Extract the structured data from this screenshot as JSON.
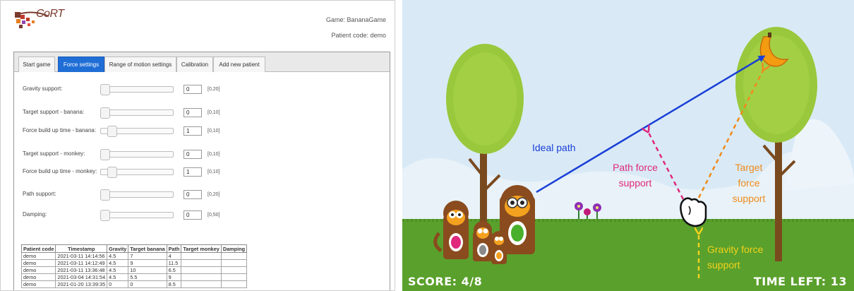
{
  "header": {
    "logo_text": "CoRT",
    "game_line": "Game: BananaGame",
    "patient_line": "Patient code: demo"
  },
  "tabs": [
    {
      "label": "Start game",
      "active": false
    },
    {
      "label": "Force settings",
      "active": true
    },
    {
      "label": "Range of motion settings",
      "active": false
    },
    {
      "label": "Calibration",
      "active": false
    },
    {
      "label": "Add new patient",
      "active": false
    }
  ],
  "settings": [
    {
      "label": "Gravity support:",
      "value": "0",
      "range": "[0,20]"
    },
    {
      "label": "Target support - banana:",
      "value": "0",
      "range": "[0,10]"
    },
    {
      "label": "Force build up time - banana:",
      "value": "1",
      "range": "[0,10]"
    },
    {
      "label": "Target support - monkey:",
      "value": "0",
      "range": "[0,10]"
    },
    {
      "label": "Force build up time - monkey:",
      "value": "1",
      "range": "[0,10]"
    },
    {
      "label": "Path support:",
      "value": "0",
      "range": "[0,20]"
    },
    {
      "label": "Damping:",
      "value": "0",
      "range": "[0,50]"
    }
  ],
  "table": {
    "headers": [
      "Patient code",
      "Timestamp",
      "Gravity",
      "Target banana",
      "Path",
      "Target monkey",
      "Damping"
    ],
    "rows": [
      [
        "demo",
        "2021-03-11 14:14:56",
        "4.5",
        "7",
        "4",
        "",
        ""
      ],
      [
        "demo",
        "2021-03-11 14:12:49",
        "4.5",
        "9",
        "11.5",
        "",
        ""
      ],
      [
        "demo",
        "2021-03-11 13:36:48",
        "4.5",
        "10",
        "6.5",
        "",
        ""
      ],
      [
        "demo",
        "2021-03-04 14:31:54",
        "4.5",
        "5.5",
        "9",
        "",
        ""
      ],
      [
        "demo",
        "2021-01-20 13:39:35",
        "0",
        "0",
        "8.5",
        "",
        ""
      ]
    ]
  },
  "game": {
    "score": "SCORE: 4/8",
    "time_left": "TIME LEFT: 13",
    "annotations": {
      "ideal_path": "Ideal path",
      "path_force_1": "Path force",
      "path_force_2": "support",
      "target_force_1": "Target",
      "target_force_2": "force",
      "target_force_3": "support",
      "gravity_force_1": "Gravity force",
      "gravity_force_2": "support"
    },
    "colors": {
      "sky": "#d7e9f5",
      "grass": "#5aa02c",
      "ideal_path": "#1a3fd6",
      "path_force": "#e0287c",
      "target_force": "#f08a1c",
      "gravity_force": "#f2d21c"
    }
  }
}
